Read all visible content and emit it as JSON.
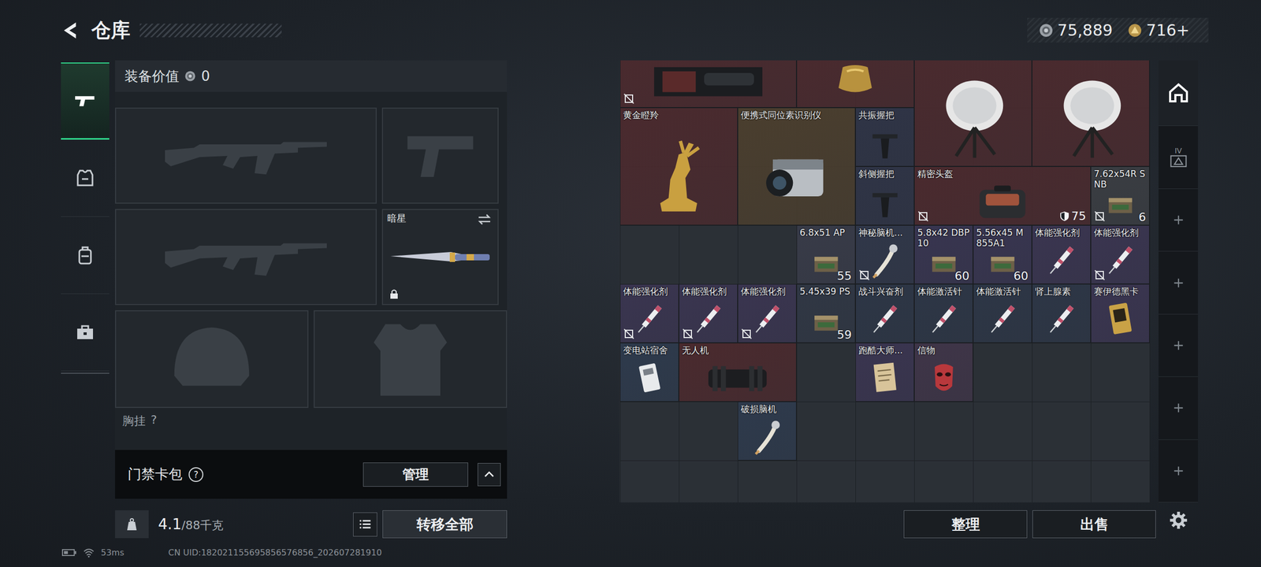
{
  "header": {
    "title": "仓库",
    "currency": [
      {
        "amount": "75,889",
        "kind": "silver"
      },
      {
        "amount": "716+",
        "kind": "gold"
      }
    ]
  },
  "side_tabs": [
    {
      "kind": "weapons",
      "selected": true
    },
    {
      "kind": "armor",
      "selected": false
    },
    {
      "kind": "backpack",
      "selected": false
    },
    {
      "kind": "toolbox",
      "selected": false
    }
  ],
  "equipment": {
    "value_label": "装备价值",
    "value": "0",
    "slots": [
      {
        "kind": "rifle"
      },
      {
        "kind": "pistol"
      },
      {
        "kind": "rifle"
      },
      {
        "kind": "knife",
        "label": "暗星",
        "locked": true
      },
      {
        "kind": "helmet"
      },
      {
        "kind": "armor"
      }
    ],
    "chest_label": "胸挂",
    "chest_hint": "?"
  },
  "card_pack": {
    "label": "门禁卡包",
    "hint": "?",
    "button": "管理"
  },
  "weight": {
    "value": "4.1",
    "capacity": "/88千克"
  },
  "transfer_button": "转移全部",
  "inventory": {
    "items": [
      {
        "kind": "case",
        "color": "#4a2a2e",
        "locked": true
      },
      {
        "kind": "gold",
        "color": "#4a2a2e",
        "locked": false
      },
      {
        "kind": "dish",
        "color": "#4a2a2e",
        "locked": false
      },
      {
        "kind": "dish",
        "color": "#4a2a2e",
        "locked": false
      },
      {
        "name": "黄金瞪羚",
        "kind": "statue",
        "color": "#4a2a2e",
        "locked": false
      },
      {
        "name": "便携式同位素识别仪",
        "kind": "camera",
        "color": "#4a3e2e",
        "locked": false
      },
      {
        "name": "共振握把",
        "kind": "grip",
        "color": "#2f3446",
        "locked": false
      },
      {
        "name": "斜侧握把",
        "kind": "grip",
        "color": "#2f3446",
        "locked": false
      },
      {
        "name": "精密头盔",
        "kind": "helmet",
        "color": "#4a2a2e",
        "locked": true,
        "armor": "75"
      },
      {
        "name": "7.62x54R SNB",
        "kind": "ammo",
        "color": "#3a3d42",
        "locked": true,
        "count": "6"
      },
      {
        "name": "6.8x51 AP",
        "kind": "ammo",
        "color": "#383b48",
        "locked": false,
        "count": "55"
      },
      {
        "name": "神秘脑机...",
        "kind": "brain",
        "color": "#303749",
        "locked": true
      },
      {
        "name": "5.8x42 DBP10",
        "kind": "ammo",
        "color": "#383550",
        "locked": false,
        "count": "60"
      },
      {
        "name": "5.56x45 M855A1",
        "kind": "ammo",
        "color": "#383550",
        "locked": false,
        "count": "60"
      },
      {
        "name": "体能强化剂",
        "kind": "syringe",
        "color": "#3a3550",
        "locked": false
      },
      {
        "name": "体能强化剂",
        "kind": "syringe",
        "color": "#3a3550",
        "locked": true
      },
      {
        "name": "体能强化剂",
        "kind": "syringe",
        "color": "#3a3550",
        "locked": true
      },
      {
        "name": "体能强化剂",
        "kind": "syringe",
        "color": "#3a3550",
        "locked": true
      },
      {
        "name": "体能强化剂",
        "kind": "syringe",
        "color": "#3a3550",
        "locked": true
      },
      {
        "name": "5.45x39 PS",
        "kind": "ammo",
        "color": "#303744",
        "locked": false,
        "count": "59"
      },
      {
        "name": "战斗兴奋剂",
        "kind": "syringe",
        "color": "#2d3646",
        "locked": false
      },
      {
        "name": "体能激活针",
        "kind": "syringe",
        "color": "#2d3646",
        "locked": false
      },
      {
        "name": "体能激活针",
        "kind": "syringe",
        "color": "#2d3646",
        "locked": false
      },
      {
        "name": "肾上腺素",
        "kind": "syringe",
        "color": "#2d3646",
        "locked": false
      },
      {
        "name": "赛伊德黑卡",
        "kind": "card",
        "color": "#3a3550",
        "locked": false
      },
      {
        "name": "变电站宿舍",
        "kind": "keycard",
        "color": "#2e3a4c",
        "locked": false
      },
      {
        "name": "无人机",
        "kind": "drone",
        "color": "#4a2a2e",
        "locked": false
      },
      {
        "name": "跑酷大师...",
        "kind": "doc",
        "color": "#3a3550",
        "locked": false
      },
      {
        "name": "信物",
        "kind": "mask",
        "color": "#3f3548",
        "locked": false
      },
      {
        "name": "破损脑机",
        "kind": "brain",
        "color": "#2e3a4c",
        "locked": false
      }
    ]
  },
  "inventory_buttons": [
    "整理",
    "出售"
  ],
  "right_tabs": [
    {
      "kind": "stash",
      "selected": true
    },
    {
      "kind": "tier",
      "label": "IV",
      "selected": false
    },
    {
      "kind": "add",
      "selected": false
    },
    {
      "kind": "add",
      "selected": false
    },
    {
      "kind": "add",
      "selected": false
    },
    {
      "kind": "add",
      "selected": false
    },
    {
      "kind": "add",
      "selected": false
    }
  ],
  "status_bar": {
    "ping": "53ms",
    "uid": "CN UID:182021155695856576856_202607281910"
  }
}
